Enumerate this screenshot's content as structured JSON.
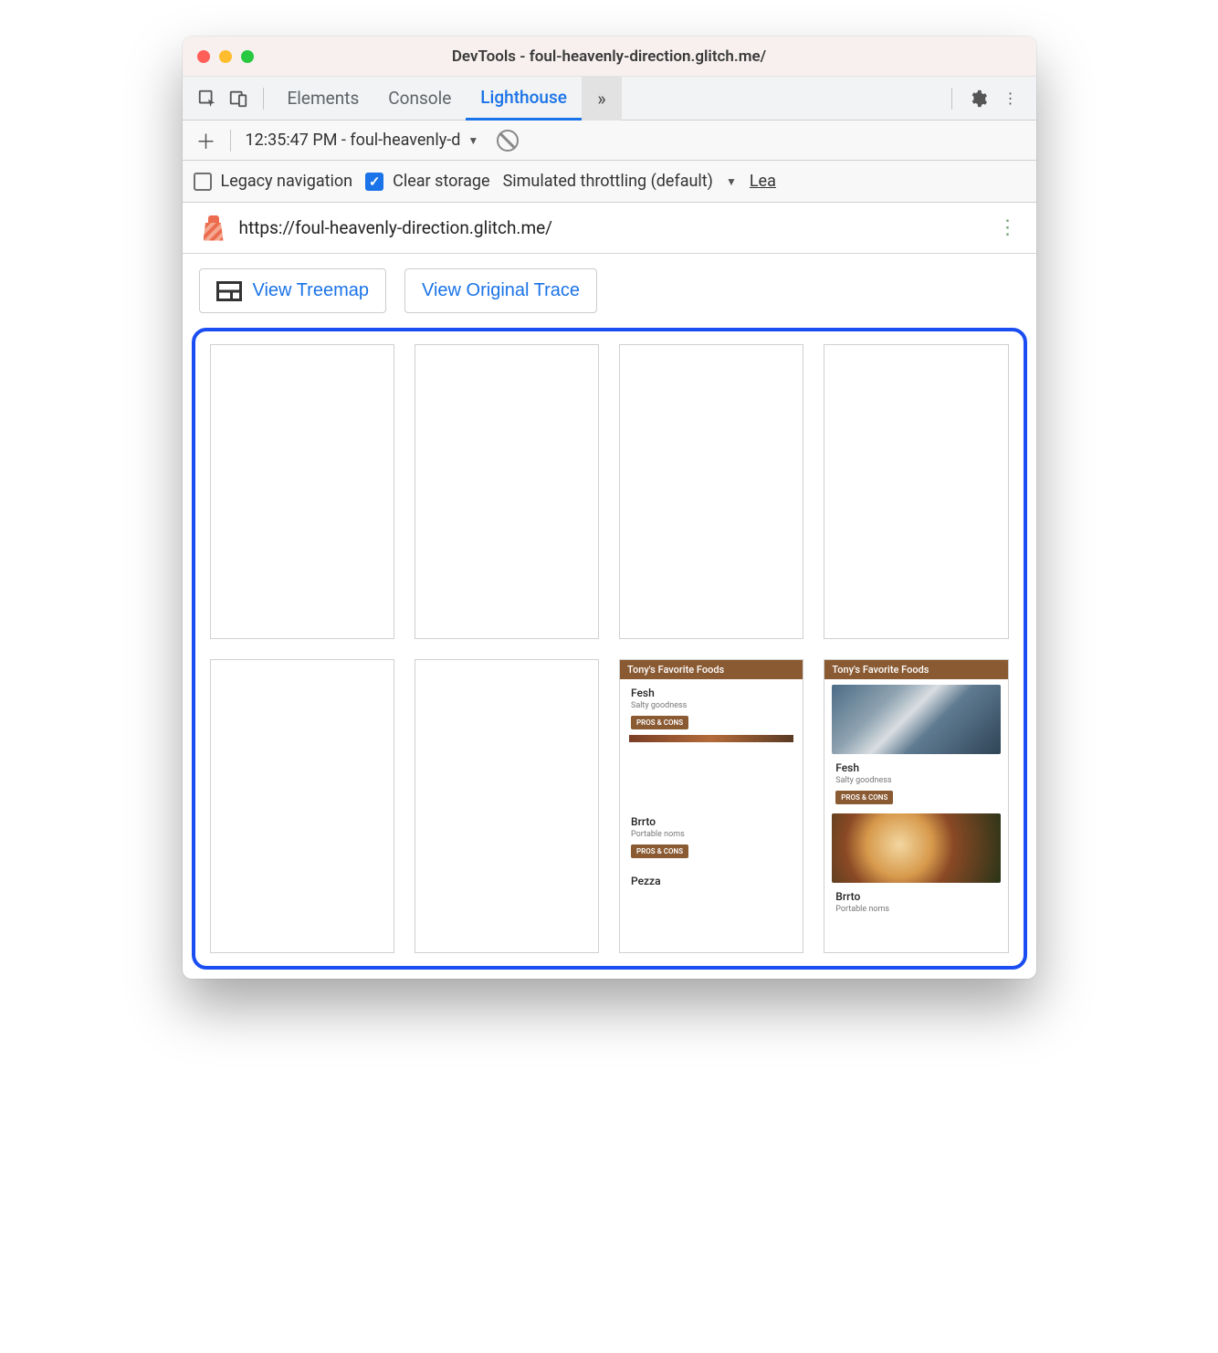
{
  "window": {
    "title": "DevTools - foul-heavenly-direction.glitch.me/"
  },
  "tabs": {
    "elements": "Elements",
    "console": "Console",
    "lighthouse": "Lighthouse",
    "overflow": "»"
  },
  "runbar": {
    "selected": "12:35:47 PM - foul-heavenly-d"
  },
  "options": {
    "legacy_nav": "Legacy navigation",
    "clear_storage": "Clear storage",
    "throttling": "Simulated throttling (default)",
    "learn_more": "Lea"
  },
  "url": "https://foul-heavenly-direction.glitch.me/",
  "actions": {
    "view_treemap": "View Treemap",
    "view_trace": "View Original Trace"
  },
  "filmstrip": {
    "header": "Tony's Favorite Foods",
    "items": [
      {
        "title": "Fesh",
        "subtitle": "Salty goodness",
        "button": "PROS & CONS"
      },
      {
        "title": "Brrto",
        "subtitle": "Portable noms",
        "button": "PROS & CONS"
      },
      {
        "title": "Pezza",
        "subtitle": "",
        "button": ""
      }
    ]
  }
}
